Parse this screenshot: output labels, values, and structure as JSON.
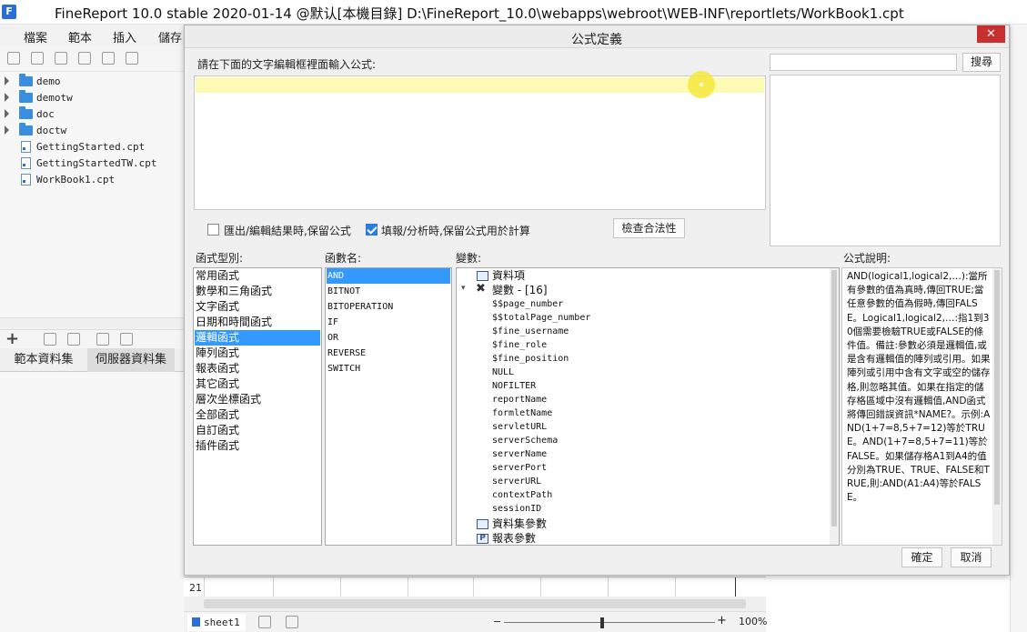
{
  "window": {
    "title": "FineReport 10.0 stable 2020-01-14 @默认[本機目錄]   D:\\FineReport_10.0\\webapps\\webroot\\WEB-INF\\reportlets/WorkBook1.cpt",
    "logo_letter": "F"
  },
  "menu": {
    "items": [
      "檔案",
      "範本",
      "插入",
      "儲存"
    ]
  },
  "tree": {
    "items": [
      {
        "type": "folder",
        "label": "demo"
      },
      {
        "type": "folder",
        "label": "demotw"
      },
      {
        "type": "folder",
        "label": "doc"
      },
      {
        "type": "folder",
        "label": "doctw"
      },
      {
        "type": "file",
        "label": "GettingStarted.cpt"
      },
      {
        "type": "file",
        "label": "GettingStartedTW.cpt"
      },
      {
        "type": "file",
        "label": "WorkBook1.cpt"
      }
    ]
  },
  "datasets": {
    "tab_template": "範本資料集",
    "tab_server": "伺服器資料集",
    "add_symbol": "+"
  },
  "sheet": {
    "row_number": "21",
    "tab_name": "sheet1",
    "zoom": "100%",
    "zoom_minus": "−",
    "zoom_plus": "+"
  },
  "dialog": {
    "title": "公式定義",
    "close_symbol": "✕",
    "editor_prompt": "請在下面的文字編輯框裡面輸入公式:",
    "editor_value": "",
    "search_value": "",
    "search_button": "搜尋",
    "option_export": "匯出/編輯結果時,保留公式",
    "option_export_checked": false,
    "option_fill": "填報/分析時,保留公式用於計算",
    "option_fill_checked": true,
    "check_button": "檢查合法性",
    "types_label": "函式型別:",
    "functions_label": "函數名:",
    "variables_label": "變數:",
    "description_label": "公式說明:",
    "ok_button": "確定",
    "cancel_button": "取消",
    "function_types": [
      "常用函式",
      "數學和三角函式",
      "文字函式",
      "日期和時間函式",
      "邏輯函式",
      "陣列函式",
      "報表函式",
      "其它函式",
      "層次坐標函式",
      "全部函式",
      "自訂函式",
      "插件函式"
    ],
    "selected_type": "邏輯函式",
    "functions": [
      "AND",
      "BITNOT",
      "BITOPERATION",
      "IF",
      "OR",
      "REVERSE",
      "SWITCH"
    ],
    "selected_function": "AND",
    "variables": {
      "data_item": "資料項",
      "var_group": "變數 - [16]",
      "var_list": [
        "$$page_number",
        "$$totalPage_number",
        "$fine_username",
        "$fine_role",
        "$fine_position",
        "NULL",
        "NOFILTER",
        "reportName",
        "formletName",
        "servletURL",
        "serverSchema",
        "serverName",
        "serverPort",
        "serverURL",
        "contextPath",
        "sessionID"
      ],
      "dataset_params": "資料集參數",
      "report_params": "報表參數",
      "report_params_icon": "P"
    },
    "description": "AND(logical1,logical2,…):當所有參數的值為真時,傳回TRUE;當任意參數的值為假時,傳回FALSE。Logical1,logical2,…:指1到30個需要檢驗TRUE或FALSE的條件值。備註:參數必須是邏輯值,或是含有邏輯值的陣列或引用。如果陣列或引用中含有文字或空的儲存格,則忽略其值。如果在指定的儲存格區域中沒有邏輯值,AND函式將傳回錯誤資訊*NAME?。示例:AND(1+7=8,5+7=12)等於TRUE。AND(1+7=8,5+7=11)等於FALSE。如果儲存格A1到A4的值分別為TRUE、TRUE、FALSE和TRUE,則:AND(A1:A4)等於FALSE。"
  }
}
